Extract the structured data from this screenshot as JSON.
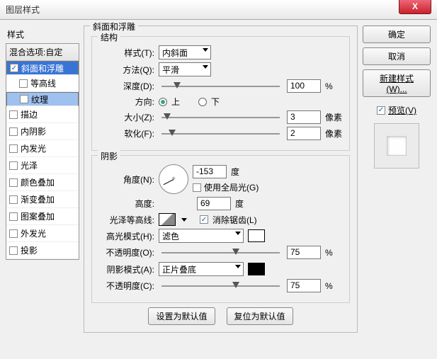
{
  "window": {
    "title": "图层样式"
  },
  "buttons": {
    "close": "X",
    "ok": "确定",
    "cancel": "取消",
    "newstyle": "新建样式(W)...",
    "setdefault": "设置为默认值",
    "resetdefault": "复位为默认值"
  },
  "preview": {
    "label": "预览(V)",
    "checked": true
  },
  "left": {
    "header": "样式",
    "blend": "混合选项:自定",
    "items": [
      {
        "label": "斜面和浮雕",
        "checked": true,
        "selected": true
      },
      {
        "label": "等高线",
        "checked": false,
        "sub": true
      },
      {
        "label": "纹理",
        "checked": false,
        "sub": true,
        "selected": true
      },
      {
        "label": "描边",
        "checked": false
      },
      {
        "label": "内阴影",
        "checked": false
      },
      {
        "label": "内发光",
        "checked": false
      },
      {
        "label": "光泽",
        "checked": false
      },
      {
        "label": "颜色叠加",
        "checked": false
      },
      {
        "label": "渐变叠加",
        "checked": false
      },
      {
        "label": "图案叠加",
        "checked": false
      },
      {
        "label": "外发光",
        "checked": false
      },
      {
        "label": "投影",
        "checked": false
      }
    ]
  },
  "main": {
    "group_title": "斜面和浮雕",
    "structure": {
      "legend": "结构",
      "style": {
        "label": "样式(T):",
        "value": "内斜面"
      },
      "technique": {
        "label": "方法(Q):",
        "value": "平滑"
      },
      "depth": {
        "label": "深度(D):",
        "value": "100",
        "unit": "%",
        "pos": 10
      },
      "direction": {
        "label": "方向:",
        "up": "上",
        "down": "下",
        "value": "up"
      },
      "size": {
        "label": "大小(Z):",
        "value": "3",
        "unit": "像素",
        "pos": 2
      },
      "soften": {
        "label": "软化(F):",
        "value": "2",
        "unit": "像素",
        "pos": 6
      }
    },
    "shading": {
      "legend": "阴影",
      "angle": {
        "label": "角度(N):",
        "value": "-153",
        "unit": "度"
      },
      "global": {
        "label": "使用全局光(G)",
        "checked": false
      },
      "altitude": {
        "label": "高度:",
        "value": "69",
        "unit": "度"
      },
      "gloss": {
        "label": "光泽等高线:",
        "aa": "消除锯齿(L)",
        "aa_checked": true
      },
      "highlight_mode": {
        "label": "高光模式(H):",
        "value": "滤色"
      },
      "highlight_opacity": {
        "label": "不透明度(O):",
        "value": "75",
        "unit": "%",
        "pos": 60
      },
      "shadow_mode": {
        "label": "阴影模式(A):",
        "value": "正片叠底"
      },
      "shadow_opacity": {
        "label": "不透明度(C):",
        "value": "75",
        "unit": "%",
        "pos": 60
      }
    }
  }
}
